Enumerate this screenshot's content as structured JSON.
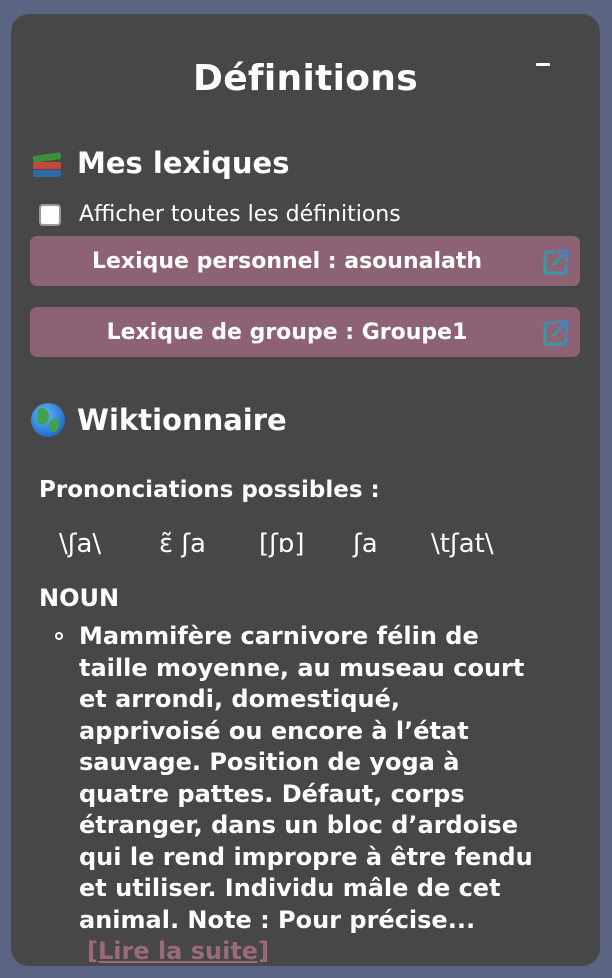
{
  "panel": {
    "title": "Définitions",
    "collapse_label": "–"
  },
  "lexicons": {
    "heading": "Mes lexiques",
    "heading_icon": "books-icon",
    "show_all_label": "Afficher toutes les définitions",
    "show_all_checked": false,
    "items": [
      {
        "label": "Lexique personnel : asounalath"
      },
      {
        "label": "Lexique de groupe : Groupe1"
      }
    ],
    "item_icon": "open-external-icon"
  },
  "wiktionary": {
    "heading": "Wiktionnaire",
    "heading_icon": "globe-icon",
    "pronunciations_label": "Prononciations possibles :",
    "pronunciations": [
      "\\ʃa\\",
      "ɛ̃ ʃa",
      "[ʃɒ]",
      "ʃa",
      "\\tʃat\\"
    ],
    "pos_label": "NOUN",
    "definition": "Mammifère carnivore félin de taille moyenne, au museau court et arrondi, domestiqué, apprivoisé ou encore à l’état sauvage. Position de yoga à quatre pattes. Défaut, corps étranger, dans un bloc d’ardoise qui le rend impropre à être fendu et utiliser. Individu mâle de cet animal. Note : Pour précise...",
    "read_more_label": "[Lire la suite]"
  },
  "colors": {
    "page_background": "#5c6484",
    "panel_background": "#474747",
    "lexicon_button": "#8d6274",
    "read_more_link": "#9a6a7c"
  }
}
